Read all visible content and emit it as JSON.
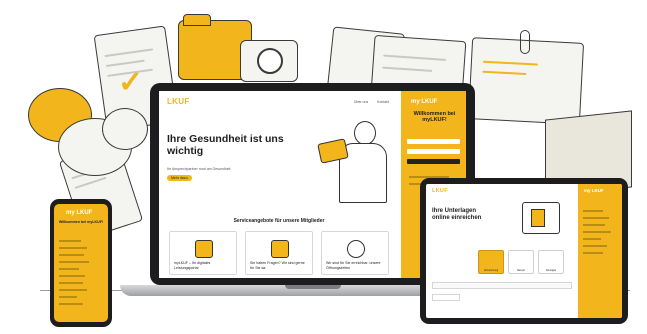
{
  "laptop": {
    "logo": "LKUF",
    "nav": [
      "Über uns",
      "Kontakt"
    ],
    "hero_title": "Ihre Gesundheit ist uns wichtig",
    "hero_sub": "Ihr Ansprechpartner rund um Gesundheit",
    "hero_button": "Mehr dazu",
    "services_title": "Serviceangebote für unsere Mitglieder",
    "cards": [
      {
        "label": "myLKUF – Ihr digitales Leistungsportal"
      },
      {
        "label": "Sie haben Fragen? Wir sind gerne für Sie da"
      },
      {
        "label": "Wir sind für Sie erreichbar: unsere Öffnungszeiten"
      }
    ],
    "login": {
      "logo": "my LKUF",
      "welcome": "Willkommen bei myLKUF!"
    }
  },
  "phone": {
    "logo": "my LKUF",
    "welcome": "Willkommen bei myLKUF!"
  },
  "tablet": {
    "logo": "LKUF",
    "title": "Ihre Unterlagen online einreichen",
    "side_logo": "my LKUF",
    "options": [
      "Arztrechnung",
      "Rezept",
      "Sonstiges"
    ]
  },
  "colors": {
    "accent": "#f2b61c",
    "device": "#1d1d1f",
    "ink": "#222222"
  }
}
